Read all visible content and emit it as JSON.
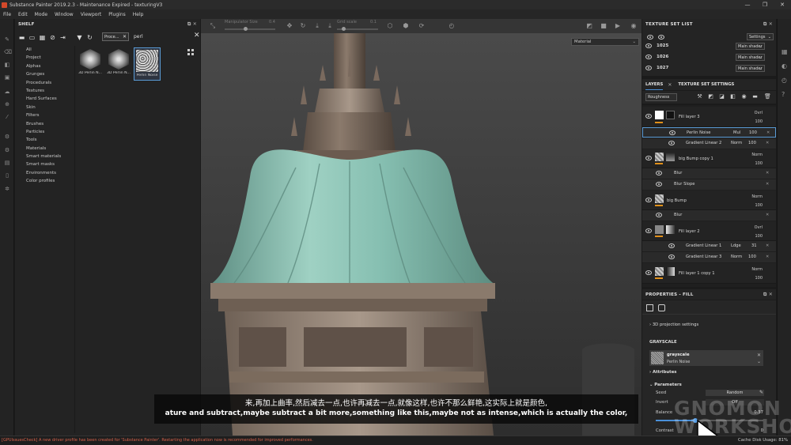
{
  "window": {
    "title": "Substance Painter 2019.2.3 - Maintenance Expired - texturingV3",
    "buttons": [
      "—",
      "❐",
      "✕"
    ]
  },
  "menu": [
    "File",
    "Edit",
    "Mode",
    "Window",
    "Viewport",
    "Plugins",
    "Help"
  ],
  "shelf": {
    "title": "SHELF",
    "filter_chip": "Proce...",
    "search_value": "perl",
    "categories": [
      "All",
      "Project",
      "Alphas",
      "Grunges",
      "Procedurals",
      "Textures",
      "Hard Surfaces",
      "Skin",
      "Filters",
      "Brushes",
      "Particles",
      "Tools",
      "Materials",
      "Smart materials",
      "Smart masks",
      "Environments",
      "Color profiles"
    ],
    "items": [
      "3D Perlin N...",
      "3D Perlin N...",
      "Perlin Noise"
    ]
  },
  "viewport": {
    "manipulator_label": "Manipulator Size",
    "manipulator_value": "0.4",
    "gridscale_label": "Grid scale",
    "gridscale_value": "0.1",
    "display_mode": "Material"
  },
  "subtitles": {
    "zh": "来,再加上曲率,然后减去一点,也许再减去一点,就像这样,也许不那么鲜艳,这实际上就是颜色,",
    "en": "ature and subtract,maybe subtract a bit more,something like this,maybe not as intense,which is actually the color,"
  },
  "watermark": {
    "line1": "GNOMON",
    "line2": "WORKSHOP"
  },
  "texture_set_list": {
    "title": "TEXTURE SET LIST",
    "settings_label": "Settings",
    "rows": [
      {
        "name": "1025",
        "shader": "Main shader"
      },
      {
        "name": "1026",
        "shader": "Main shader"
      },
      {
        "name": "1027",
        "shader": "Main shader"
      }
    ]
  },
  "layers": {
    "tab_layers": "LAYERS",
    "tab_settings": "TEXTURE SET SETTINGS",
    "channel": "Roughness",
    "rows": [
      {
        "name": "Fill layer 3",
        "blend": "Ovrl",
        "opacity": "100"
      },
      {
        "name": "Perlin Noise",
        "blend": "Mul",
        "opacity": "100"
      },
      {
        "name": "Gradient Linear 2",
        "blend": "Norm",
        "opacity": "100"
      },
      {
        "name": "big Bump copy 1",
        "blend": "Norm",
        "opacity": "100"
      },
      {
        "name": "Blur",
        "blend": "",
        "opacity": ""
      },
      {
        "name": "Blur Slope",
        "blend": "",
        "opacity": ""
      },
      {
        "name": "big Bump",
        "blend": "Norm",
        "opacity": "100"
      },
      {
        "name": "Blur",
        "blend": "",
        "opacity": ""
      },
      {
        "name": "Fill layer 2",
        "blend": "Ovrl",
        "opacity": "100"
      },
      {
        "name": "Gradient Linear 1",
        "blend": "Ldge",
        "opacity": "31"
      },
      {
        "name": "Gradient Linear 3",
        "blend": "Norm",
        "opacity": "100"
      },
      {
        "name": "Fill layer 1 copy 1",
        "blend": "Norm",
        "opacity": "100"
      }
    ]
  },
  "properties": {
    "title": "PROPERTIES - FILL",
    "projection": "3D projection settings",
    "grayscale_section": "GRAYSCALE",
    "grayscale_name": "grayscale",
    "grayscale_source": "Perlin Noise",
    "attributes": "Attributes",
    "parameters": "Parameters",
    "seed_label": "Seed",
    "seed_value": "Random",
    "invert_label": "Invert",
    "invert_value": "Off",
    "balance_label": "Balance",
    "balance_value": "0.37",
    "contrast_label": "Contrast",
    "contrast_value": "0"
  },
  "status": {
    "message": "[GPUIssuesCheck] A new driver profile has been created for 'Substance Painter'. Restarting the application now is recommended for improved performances.",
    "cache": "Cache Disk Usage:  81%"
  }
}
